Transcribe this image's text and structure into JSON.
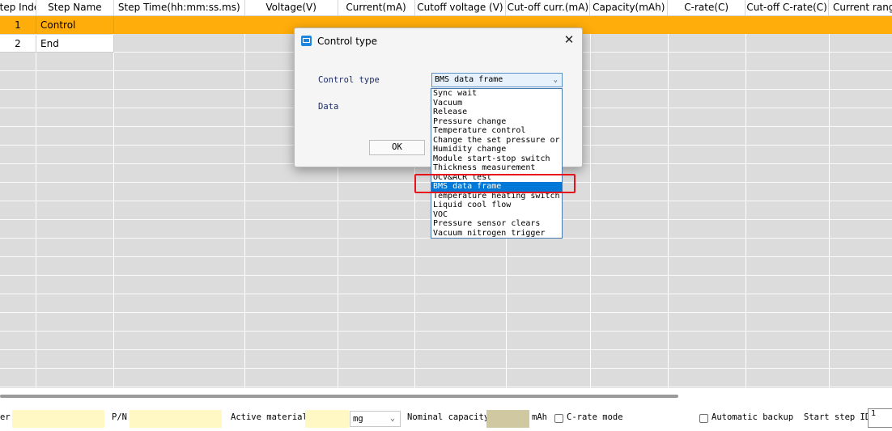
{
  "table": {
    "columns": [
      "Step Index",
      "Step Name",
      "Step Time(hh:mm:ss.ms)",
      "Voltage(V)",
      "Current(mA)",
      "Cutoff voltage (V)",
      "Cut-off curr.(mA)",
      "Capacity(mAh)",
      "C-rate(C)",
      "Cut-off C-rate(C)",
      "Current rang"
    ],
    "rows": [
      {
        "index": "1",
        "name": "Control",
        "selected": true
      },
      {
        "index": "2",
        "name": "End",
        "selected": false
      }
    ],
    "selected_row_color": "#ffad0a"
  },
  "dialog": {
    "title": "Control type",
    "control_type_label": "Control type",
    "data_label": "Data",
    "selected_value": "BMS data frame",
    "ok_label": "OK",
    "close_glyph": "✕",
    "icon": "app-window-icon"
  },
  "dropdown": {
    "options": [
      "Sync wait",
      "Vacuum",
      "Release",
      "Pressure change",
      "Temperature control",
      "Change the set pressure or t",
      "Humidity change",
      "Module start-stop switch",
      "Thickness measurement",
      "OCV&ACR test",
      "BMS data frame",
      "Temperature heating switch",
      "Liquid cool flow",
      "VOC",
      "Pressure sensor clears",
      "Vacuum nitrogen trigger"
    ],
    "selected_index": 10,
    "highlight_color": "#e8121c"
  },
  "form": {
    "barcode_label_fragment": "er",
    "pn_label": "P/N",
    "active_material_label": "Active material",
    "unit_value": "mg",
    "nominal_capacity_label": "Nominal capacity",
    "capacity_unit": "mAh",
    "crate_mode_label": "C-rate mode",
    "auto_backup_label": "Automatic backup",
    "start_step_label": "Start step ID",
    "start_step_value": "1"
  }
}
